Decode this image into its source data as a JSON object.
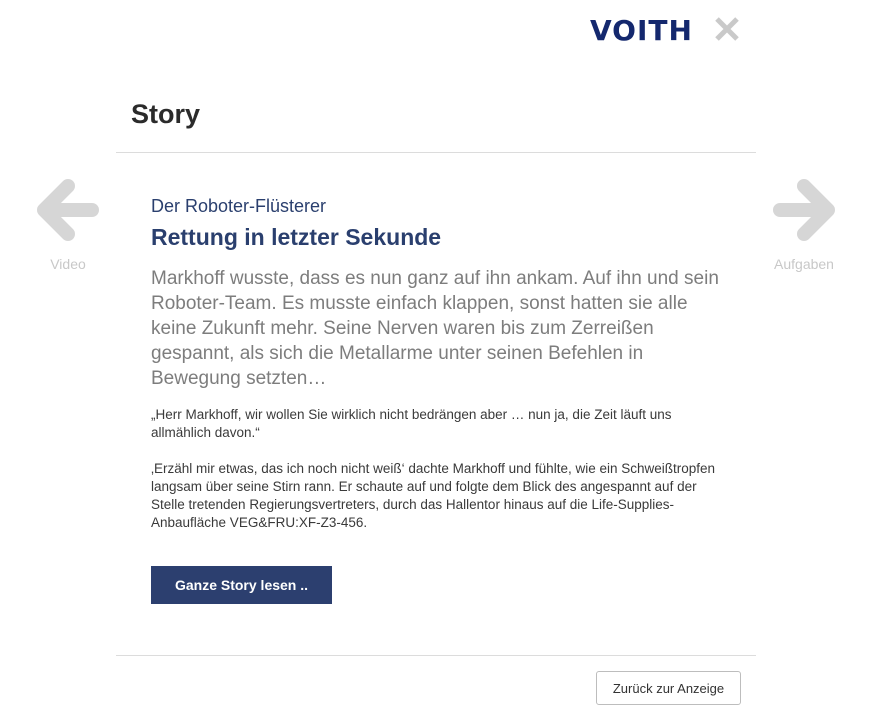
{
  "brand": {
    "logo_text": "VOITH",
    "color": "#14286e"
  },
  "header": {
    "close_icon": "close-icon"
  },
  "page": {
    "title": "Story"
  },
  "nav": {
    "prev": {
      "label": "Video",
      "icon": "arrow-left-icon"
    },
    "next": {
      "label": "Aufgaben",
      "icon": "arrow-right-icon"
    }
  },
  "story": {
    "eyebrow": "Der Roboter-Flüsterer",
    "headline": "Rettung in letzter Sekunde",
    "lead": "Markhoff wusste, dass es nun ganz auf ihn ankam. Auf ihn und sein Roboter-Team. Es musste einfach klappen, sonst hatten sie alle keine Zukunft mehr. Seine Nerven waren bis zum Zerreißen gespannt, als sich die Metallarme unter seinen Befehlen in Bewegung setzten…",
    "paragraph1": "„Herr Markhoff, wir wollen Sie wirklich nicht bedrängen aber … nun ja, die Zeit läuft uns allmählich davon.“",
    "paragraph2": "‚Erzähl mir etwas, das ich noch nicht weiß‘ dachte Markhoff und fühlte, wie ein Schweißtropfen langsam über seine Stirn rann. Er schaute auf und folgte dem Blick des angespannt auf der Stelle tretenden Regierungsvertreters, durch das Hallentor hinaus auf die Life-Supplies-Anbaufläche VEG&FRU:XF-Z3-456."
  },
  "actions": {
    "read_more": "Ganze Story lesen ..",
    "back": "Zurück zur Anzeige"
  },
  "colors": {
    "accent": "#2c3f6f",
    "headline": "#2a3f6e",
    "lead_text": "#7d7d7d",
    "nav_icon": "#d6d6d6"
  }
}
